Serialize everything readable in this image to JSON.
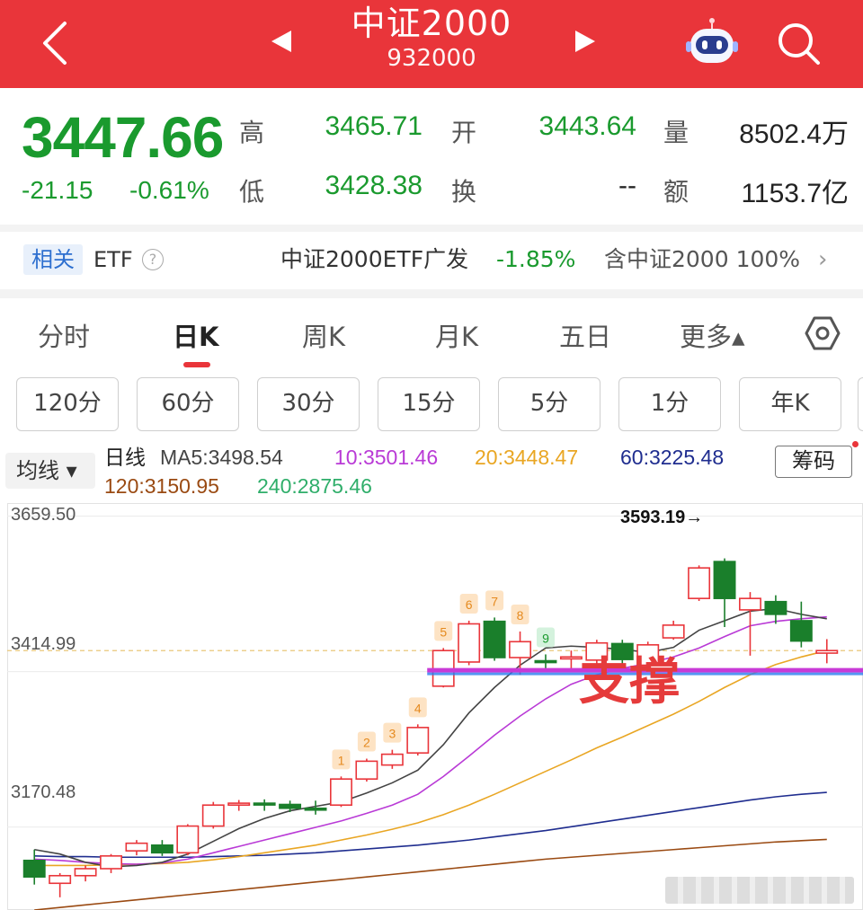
{
  "header": {
    "title": "中证2000",
    "code": "932000",
    "bg_color": "#e9353a"
  },
  "quote": {
    "price": "3447.66",
    "change": "-21.15",
    "change_pct": "-0.61%",
    "high_label": "高",
    "high": "3465.71",
    "open_label": "开",
    "open": "3443.64",
    "volume_label": "量",
    "volume": "8502.4万",
    "low_label": "低",
    "low": "3428.38",
    "turnover_label": "换",
    "turnover": "--",
    "amount_label": "额",
    "amount": "1153.7亿",
    "down_color": "#1a9a2e"
  },
  "etf": {
    "tag": "相关",
    "label": "ETF",
    "help": "?",
    "name": "中证2000ETF广发",
    "pct": "-1.85%",
    "holding": "含中证2000 100%",
    "arrow": "›"
  },
  "tabs": [
    {
      "label": "分时"
    },
    {
      "label": "日K"
    },
    {
      "label": "周K"
    },
    {
      "label": "月K"
    },
    {
      "label": "五日"
    },
    {
      "label": "更多▴"
    }
  ],
  "periods": [
    "120分",
    "60分",
    "30分",
    "15分",
    "5分",
    "1分",
    "年K"
  ],
  "ma_bar": {
    "selector": "均线 ▾",
    "daily": "日线",
    "ma5": "MA5:3498.54",
    "ma10": "10:3501.46",
    "ma20": "20:3448.47",
    "ma60": "60:3225.48",
    "ma120": "120:3150.95",
    "ma240": "240:2875.46",
    "chip_button": "筹码",
    "colors": {
      "ma5": "#444444",
      "ma10": "#b93ad6",
      "ma20": "#e9a623",
      "ma60": "#1f2d8f",
      "ma120": "#9a4a12",
      "ma240": "#2fae6a"
    }
  },
  "chart_data": {
    "type": "candlestick",
    "y_labels": [
      "3659.50",
      "3414.99",
      "3170.48"
    ],
    "max_label": "3593.19→",
    "annotation": "支撑",
    "sequence_markers": [
      "1",
      "2",
      "3",
      "4",
      "5",
      "6",
      "7",
      "8",
      "9"
    ],
    "up_color": "#e9353a",
    "down_color": "#1a7f2b",
    "candles": [
      {
        "o": 3118,
        "h": 3135,
        "l": 3080,
        "c": 3092
      },
      {
        "o": 3082,
        "h": 3098,
        "l": 3060,
        "c": 3094
      },
      {
        "o": 3094,
        "h": 3110,
        "l": 3085,
        "c": 3105
      },
      {
        "o": 3105,
        "h": 3128,
        "l": 3098,
        "c": 3125
      },
      {
        "o": 3133,
        "h": 3150,
        "l": 3126,
        "c": 3145
      },
      {
        "o": 3142,
        "h": 3150,
        "l": 3125,
        "c": 3130
      },
      {
        "o": 3130,
        "h": 3175,
        "l": 3126,
        "c": 3172
      },
      {
        "o": 3172,
        "h": 3210,
        "l": 3168,
        "c": 3205
      },
      {
        "o": 3205,
        "h": 3213,
        "l": 3196,
        "c": 3208
      },
      {
        "o": 3208,
        "h": 3214,
        "l": 3196,
        "c": 3206
      },
      {
        "o": 3206,
        "h": 3212,
        "l": 3194,
        "c": 3200
      },
      {
        "o": 3200,
        "h": 3212,
        "l": 3190,
        "c": 3198
      },
      {
        "o": 3205,
        "h": 3250,
        "l": 3202,
        "c": 3246
      },
      {
        "o": 3246,
        "h": 3278,
        "l": 3242,
        "c": 3274
      },
      {
        "o": 3268,
        "h": 3292,
        "l": 3262,
        "c": 3285
      },
      {
        "o": 3287,
        "h": 3332,
        "l": 3283,
        "c": 3327
      },
      {
        "o": 3392,
        "h": 3452,
        "l": 3390,
        "c": 3448
      },
      {
        "o": 3430,
        "h": 3495,
        "l": 3425,
        "c": 3490
      },
      {
        "o": 3494,
        "h": 3500,
        "l": 3432,
        "c": 3437
      },
      {
        "o": 3437,
        "h": 3478,
        "l": 3410,
        "c": 3462
      },
      {
        "o": 3432,
        "h": 3442,
        "l": 3418,
        "c": 3430
      },
      {
        "o": 3435,
        "h": 3448,
        "l": 3420,
        "c": 3438
      },
      {
        "o": 3433,
        "h": 3465,
        "l": 3424,
        "c": 3460
      },
      {
        "o": 3459,
        "h": 3465,
        "l": 3427,
        "c": 3434
      },
      {
        "o": 3425,
        "h": 3462,
        "l": 3418,
        "c": 3457
      },
      {
        "o": 3468,
        "h": 3495,
        "l": 3465,
        "c": 3488
      },
      {
        "o": 3530,
        "h": 3582,
        "l": 3526,
        "c": 3578
      },
      {
        "o": 3588,
        "h": 3593,
        "l": 3485,
        "c": 3530
      },
      {
        "o": 3512,
        "h": 3540,
        "l": 3440,
        "c": 3530
      },
      {
        "o": 3525,
        "h": 3535,
        "l": 3490,
        "c": 3505
      },
      {
        "o": 3495,
        "h": 3525,
        "l": 3453,
        "c": 3463
      },
      {
        "o": 3444,
        "h": 3466,
        "l": 3428,
        "c": 3448
      }
    ],
    "ma5": [
      3135,
      3128,
      3115,
      3108,
      3110,
      3115,
      3128,
      3148,
      3168,
      3184,
      3196,
      3203,
      3210,
      3224,
      3240,
      3260,
      3300,
      3350,
      3390,
      3425,
      3452,
      3455,
      3453,
      3450,
      3445,
      3453,
      3480,
      3495,
      3510,
      3514,
      3505,
      3498
    ],
    "ma10": [
      3120,
      3118,
      3115,
      3113,
      3112,
      3114,
      3120,
      3130,
      3140,
      3150,
      3160,
      3170,
      3180,
      3192,
      3205,
      3222,
      3250,
      3282,
      3315,
      3345,
      3372,
      3395,
      3410,
      3420,
      3428,
      3438,
      3452,
      3470,
      3487,
      3494,
      3498,
      3501
    ],
    "ma20": [
      3110,
      3110,
      3110,
      3111,
      3112,
      3113,
      3115,
      3119,
      3124,
      3130,
      3136,
      3142,
      3150,
      3158,
      3167,
      3177,
      3190,
      3205,
      3222,
      3240,
      3258,
      3276,
      3295,
      3312,
      3330,
      3348,
      3368,
      3390,
      3410,
      3426,
      3438,
      3448
    ],
    "ma60": [
      3125,
      3124,
      3124,
      3123,
      3123,
      3123,
      3123,
      3124,
      3125,
      3126,
      3128,
      3130,
      3133,
      3136,
      3139,
      3142,
      3146,
      3150,
      3155,
      3160,
      3165,
      3171,
      3177,
      3183,
      3189,
      3195,
      3201,
      3207,
      3213,
      3218,
      3222,
      3225
    ],
    "ma120": [
      3040,
      3044,
      3048,
      3052,
      3056,
      3060,
      3064,
      3068,
      3072,
      3076,
      3080,
      3084,
      3088,
      3092,
      3096,
      3100,
      3104,
      3108,
      3112,
      3116,
      3120,
      3123,
      3126,
      3129,
      3132,
      3135,
      3138,
      3141,
      3144,
      3147,
      3149,
      3151
    ],
    "support_level": 3417,
    "current_price": 3448,
    "ylim": [
      3040,
      3680
    ]
  }
}
